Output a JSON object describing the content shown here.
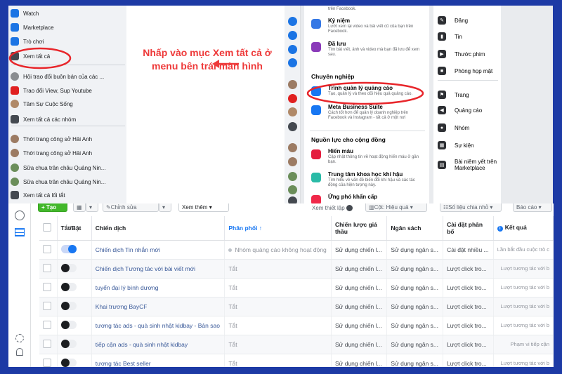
{
  "left_menu": {
    "items": [
      {
        "label": "Watch",
        "icon": "watch-icon",
        "color": "#1b74e4"
      },
      {
        "label": "Marketplace",
        "icon": "marketplace-icon",
        "color": "#1b74e4"
      },
      {
        "label": "Trò chơi",
        "icon": "gaming-icon",
        "color": "#1b74e4"
      },
      {
        "label": "Xem tất cả",
        "icon": "grid-icon",
        "color": "#444950"
      },
      {
        "label": "Hội trao đổi buôn bán của các ...",
        "icon": "group-avatar-icon",
        "color": "#8a8d91"
      },
      {
        "label": "Trao đổi View, Sup Youtube",
        "icon": "youtube-icon",
        "color": "#e02020"
      },
      {
        "label": "Tâm Sự Cuộc Sống",
        "icon": "group-avatar-icon",
        "color": "#b08968"
      },
      {
        "label": "Xem tất cả các nhóm",
        "icon": "groups-icon",
        "color": "#444950"
      },
      {
        "label": "Thời trang công sở Hải Anh",
        "icon": "page-avatar-icon",
        "color": "#9c7b63"
      },
      {
        "label": "Thời trang công sở Hải Anh",
        "icon": "page-avatar-icon",
        "color": "#9c7b63"
      },
      {
        "label": "Sữa chua trân châu Quảng Nin...",
        "icon": "page-avatar-icon",
        "color": "#6b8e5a"
      },
      {
        "label": "Sữa chua trân châu Quảng Nin...",
        "icon": "page-avatar-icon",
        "color": "#6b8e5a"
      },
      {
        "label": "Xem tất cả lối tắt",
        "icon": "link-icon",
        "color": "#444950"
      }
    ]
  },
  "instruction": {
    "text": "Nhấp vào mục Xem tất cả ở menu bên trái màn hình",
    "color": "#ee3a3a"
  },
  "right_menu": {
    "top_fragment": "trên Facebook.",
    "features": [
      {
        "title": "Kỷ niệm",
        "desc": "Lướt xem lại video và bài viết cũ của bạn trên Facebook.",
        "icon": "memories-icon",
        "color": "#3578e5"
      },
      {
        "title": "Đã lưu",
        "desc": "Tìm bài viết, ảnh và video mà bạn đã lưu để xem sau.",
        "icon": "bookmark-icon",
        "color": "#8a3ab9"
      }
    ],
    "section1": "Chuyên nghiệp",
    "pro_features": [
      {
        "title": "Trình quản lý quảng cáo",
        "desc": "Tạo, quản lý và theo dõi hiệu quả quảng cáo.",
        "icon": "ads-manager-icon",
        "color": "#1877f2"
      },
      {
        "title": "Meta Business Suite",
        "desc": "Cách tốt hơn để quản lý doanh nghiệp trên Facebook và Instagram - tất cả ở một nơi",
        "icon": "business-suite-icon",
        "color": "#1877f2"
      }
    ],
    "section2": "Nguồn lực cho cộng đồng",
    "community": [
      {
        "title": "Hiến máu",
        "desc": "Cập nhật thông tin về hoạt động hiến máu ở gần bạn.",
        "icon": "blood-drop-icon",
        "color": "#e41e3f"
      },
      {
        "title": "Trung tâm khoa học khí hậu",
        "desc": "Tìm hiểu về vấn đề biến đổi khí hậu và các tác động của hiện tượng này.",
        "icon": "climate-icon",
        "color": "#2abba7"
      },
      {
        "title": "Ứng phó khẩn cấp",
        "desc": "",
        "icon": "emergency-icon",
        "color": "#f02849"
      }
    ],
    "create": [
      {
        "label": "Đăng",
        "icon": "edit-icon"
      },
      {
        "label": "Tin",
        "icon": "book-icon"
      },
      {
        "label": "Thước phim",
        "icon": "reels-icon"
      },
      {
        "label": "Phòng họp mặt",
        "icon": "video-icon"
      },
      {
        "label": "Trang",
        "icon": "flag-icon"
      },
      {
        "label": "Quảng cáo",
        "icon": "megaphone-icon"
      },
      {
        "label": "Nhóm",
        "icon": "people-icon"
      },
      {
        "label": "Sự kiện",
        "icon": "calendar-icon"
      },
      {
        "label": "Bài niêm yết trên Marketplace",
        "icon": "shop-icon"
      }
    ]
  },
  "toolbar": {
    "create_label": "+ Tạo",
    "edit_label": "Chỉnh sửa",
    "more_label": "Xem thêm",
    "setup_label": "Xem thiết lập",
    "columns_label": "Cột: Hiệu quả",
    "breakdown_label": "Số liệu chia nhỏ",
    "reports_label": "Báo cáo",
    "create_color": "#42b72a"
  },
  "table": {
    "headers": [
      "Tắt/Bật",
      "Chiến dịch",
      "Phân phối ↑",
      "Chiến lược giá thầu",
      "Ngân sách",
      "Cài đặt phân bổ",
      "Kết quả"
    ],
    "rows": [
      {
        "on": true,
        "name": "Chiến dịch Tin nhắn mới",
        "delivery": "Nhóm quảng cáo không hoạt động",
        "bid": "Sử dụng chiến l...",
        "budget": "Sử dụng ngân s...",
        "attribution": "Cài đặt nhiều ...",
        "result": "Lần bắt đầu cuộc trò c"
      },
      {
        "on": false,
        "name": "Chiến dịch Tương tác với bài viết mới",
        "delivery": "Tắt",
        "bid": "Sử dụng chiến l...",
        "budget": "Sử dụng ngân s...",
        "attribution": "Lượt click tro...",
        "result": "Lượt tương tác với b"
      },
      {
        "on": false,
        "name": "tuyển đại lý bình dương",
        "delivery": "Tắt",
        "bid": "Sử dụng chiến l...",
        "budget": "Sử dụng ngân s...",
        "attribution": "Lượt click tro...",
        "result": "Lượt tương tác với b"
      },
      {
        "on": false,
        "name": "Khai trương BayCF",
        "delivery": "Tắt",
        "bid": "Sử dụng chiến l...",
        "budget": "Sử dụng ngân s...",
        "attribution": "Lượt click tro...",
        "result": "Lượt tương tác với b"
      },
      {
        "on": false,
        "name": "tương tác ads - quà sinh nhật kidbay - Bản sao",
        "delivery": "Tắt",
        "bid": "Sử dụng chiến l...",
        "budget": "Sử dụng ngân s...",
        "attribution": "Lượt click tro...",
        "result": "Lượt tương tác với b"
      },
      {
        "on": false,
        "name": "tiếp cận ads - quà sinh nhật kidbay",
        "delivery": "Tắt",
        "bid": "Sử dụng chiến l...",
        "budget": "Sử dụng ngân s...",
        "attribution": "Lượt click tro...",
        "result": "Phạm vi tiếp cận"
      },
      {
        "on": false,
        "name": "tương tác Best seller",
        "delivery": "Tắt",
        "bid": "Sử dụng chiến l...",
        "budget": "Sử dụng ngân s...",
        "attribution": "Lượt click tro...",
        "result": "Lượt tương tác với b"
      }
    ]
  },
  "highlight_color": "#e8262b",
  "frame_color": "#1d3aa5"
}
